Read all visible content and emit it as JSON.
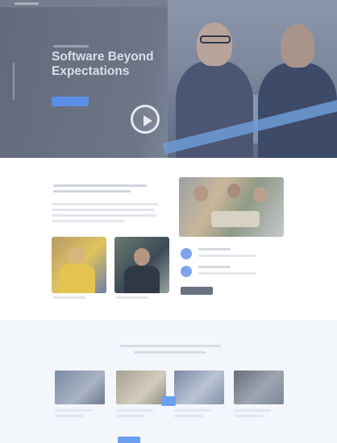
{
  "hero": {
    "title": "Software Beyond Expectations"
  },
  "services": {
    "title": ""
  },
  "about": {
    "title": ""
  },
  "colors": {
    "accent": "#5b8fe6",
    "hero_bg": "#6d7688"
  },
  "icons": {
    "play": "play-icon",
    "feature_1": "feature-icon",
    "feature_2": "feature-icon"
  }
}
